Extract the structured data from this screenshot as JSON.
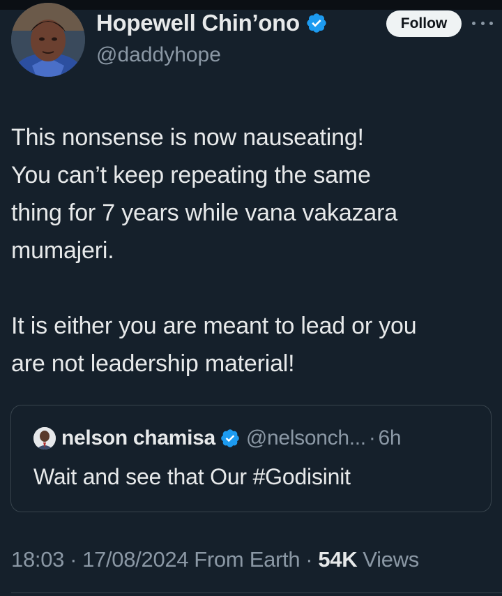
{
  "author": {
    "name": "Hopewell Chin’ono",
    "handle": "@daddyhope",
    "verified": true,
    "avatar_icon": "profile-photo"
  },
  "actions": {
    "follow_label": "Follow",
    "more_icon": "more-options-icon"
  },
  "tweet": {
    "lines_para1": [
      "This nonsense is now nauseating!",
      "You can’t keep repeating the same",
      "thing for 7 years while vana vakazara",
      "mumajeri."
    ],
    "lines_para2": [
      "It is either you are meant to lead or you",
      "are not leadership material!"
    ]
  },
  "quoted_tweet": {
    "name": "nelson chamisa",
    "handle": "@nelsonch...",
    "separator": "·",
    "time": "6h",
    "text": "Wait and see that Our #Godisinit",
    "verified": true
  },
  "meta": {
    "time": "18:03",
    "date": "17/08/2024",
    "source": "From Earth",
    "separator": "·",
    "views_count": "54K",
    "views_label": "Views"
  },
  "colors": {
    "background": "#15202b",
    "text_primary": "#e7e9ea",
    "text_secondary": "#8b98a5",
    "verified_blue": "#1d9bf0",
    "border": "#38444d"
  }
}
